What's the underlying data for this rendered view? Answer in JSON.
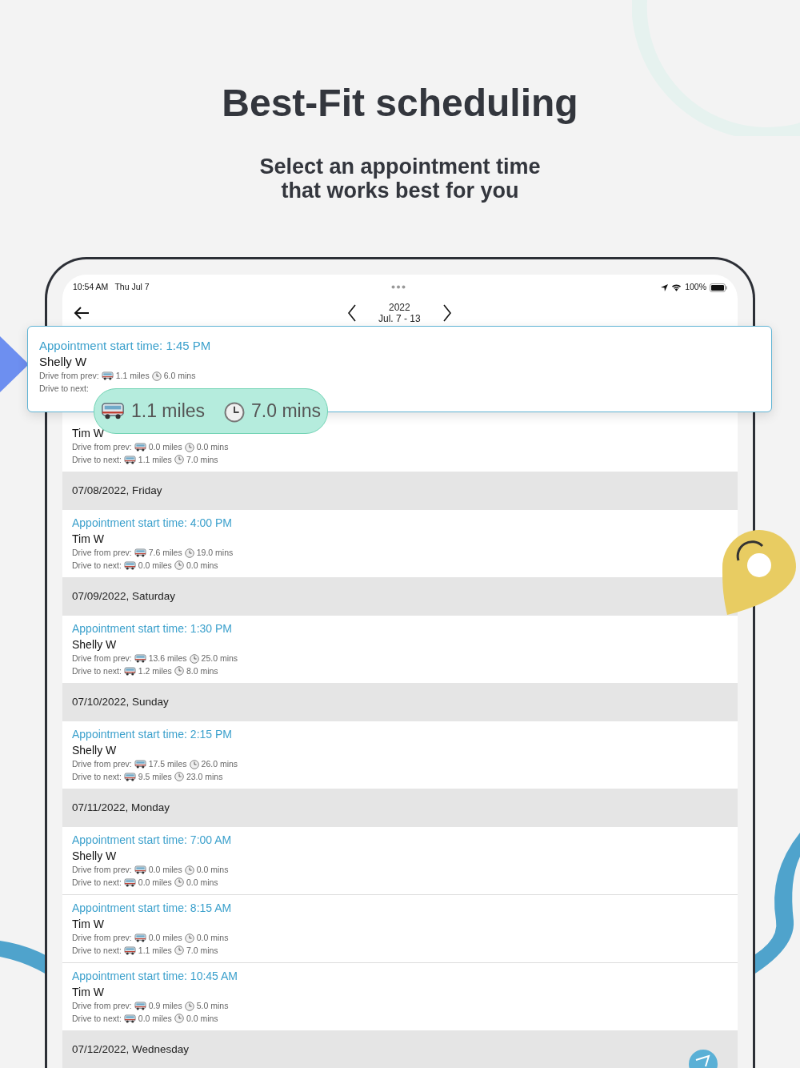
{
  "headline": "Best-Fit scheduling",
  "subheadline": [
    "Select an appointment time",
    "that works best for you"
  ],
  "status_bar": {
    "time": "10:54 AM",
    "date": "Thu Jul 7",
    "battery": "100%"
  },
  "nav": {
    "year": "2022",
    "range": "Jul. 7 - 13"
  },
  "popup": {
    "title": "Appointment start time: 1:45 PM",
    "name": "Shelly W",
    "prev_label": "Drive from prev:",
    "prev_miles": "1.1 miles",
    "prev_mins": "6.0 mins",
    "next_label": "Drive to next:"
  },
  "callout": {
    "miles": "1.1 miles",
    "mins": "7.0 mins"
  },
  "list": [
    {
      "kind": "appointment",
      "name": "Tim W",
      "prev_label": "Drive from prev:",
      "prev_miles": "0.0 miles",
      "prev_mins": "0.0 mins",
      "next_label": "Drive to next:",
      "next_miles": "1.1 miles",
      "next_mins": "7.0 mins"
    },
    {
      "kind": "header",
      "label": "07/08/2022, Friday"
    },
    {
      "kind": "appointment",
      "title": "Appointment start time: 4:00 PM",
      "name": "Tim W",
      "prev_label": "Drive from prev:",
      "prev_miles": "7.6 miles",
      "prev_mins": "19.0 mins",
      "next_label": "Drive to next:",
      "next_miles": "0.0 miles",
      "next_mins": "0.0 mins"
    },
    {
      "kind": "header",
      "label": "07/09/2022, Saturday"
    },
    {
      "kind": "appointment",
      "title": "Appointment start time: 1:30 PM",
      "name": "Shelly W",
      "prev_label": "Drive from prev:",
      "prev_miles": "13.6 miles",
      "prev_mins": "25.0 mins",
      "next_label": "Drive to next:",
      "next_miles": "1.2 miles",
      "next_mins": "8.0 mins"
    },
    {
      "kind": "header",
      "label": "07/10/2022, Sunday"
    },
    {
      "kind": "appointment",
      "title": "Appointment start time: 2:15 PM",
      "name": "Shelly W",
      "prev_label": "Drive from prev:",
      "prev_miles": "17.5 miles",
      "prev_mins": "26.0 mins",
      "next_label": "Drive to next:",
      "next_miles": "9.5 miles",
      "next_mins": "23.0 mins"
    },
    {
      "kind": "header",
      "label": "07/11/2022, Monday"
    },
    {
      "kind": "appointment",
      "title": "Appointment start time: 7:00 AM",
      "name": "Shelly W",
      "prev_label": "Drive from prev:",
      "prev_miles": "0.0 miles",
      "prev_mins": "0.0 mins",
      "next_label": "Drive to next:",
      "next_miles": "0.0 miles",
      "next_mins": "0.0 mins"
    },
    {
      "kind": "appointment",
      "title": "Appointment start time: 8:15 AM",
      "name": "Tim W",
      "prev_label": "Drive from prev:",
      "prev_miles": "0.0 miles",
      "prev_mins": "0.0 mins",
      "next_label": "Drive to next:",
      "next_miles": "1.1 miles",
      "next_mins": "7.0 mins"
    },
    {
      "kind": "appointment",
      "title": "Appointment start time: 10:45 AM",
      "name": "Tim W",
      "prev_label": "Drive from prev:",
      "prev_miles": "0.9 miles",
      "prev_mins": "5.0 mins",
      "next_label": "Drive to next:",
      "next_miles": "0.0 miles",
      "next_mins": "0.0 mins"
    },
    {
      "kind": "header",
      "label": "07/12/2022, Wednesday"
    }
  ]
}
